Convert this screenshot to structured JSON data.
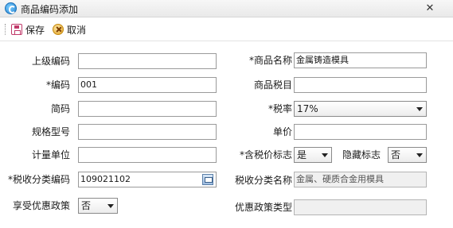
{
  "window": {
    "title": "商品编码添加",
    "close_glyph": "✕"
  },
  "toolbar": {
    "save_label": "保存",
    "cancel_label": "取消"
  },
  "form": {
    "parent_code": {
      "label": "上级编码",
      "value": ""
    },
    "product_name": {
      "label": "*商品名称",
      "value": "金属铸造模具"
    },
    "code": {
      "label": "*编码",
      "value": "001"
    },
    "product_tax_item": {
      "label": "商品税目",
      "value": ""
    },
    "short_code": {
      "label": "简码",
      "value": ""
    },
    "tax_rate": {
      "label": "*税率",
      "value": "17%"
    },
    "spec_model": {
      "label": "规格型号",
      "value": ""
    },
    "unit_price": {
      "label": "单价",
      "value": ""
    },
    "unit": {
      "label": "计量单位",
      "value": ""
    },
    "tax_included_flag": {
      "label": "*含税价标志",
      "value": "是"
    },
    "hidden_flag": {
      "label": "隐藏标志",
      "value": "否"
    },
    "tax_class_code": {
      "label": "*税收分类编码",
      "value": "109021102"
    },
    "tax_class_name": {
      "label": "税收分类名称",
      "value": "金属、硬质合金用模具"
    },
    "enjoy_preferential": {
      "label": "享受优惠政策",
      "value": "否"
    },
    "preferential_type": {
      "label": "优惠政策类型",
      "value": ""
    }
  }
}
